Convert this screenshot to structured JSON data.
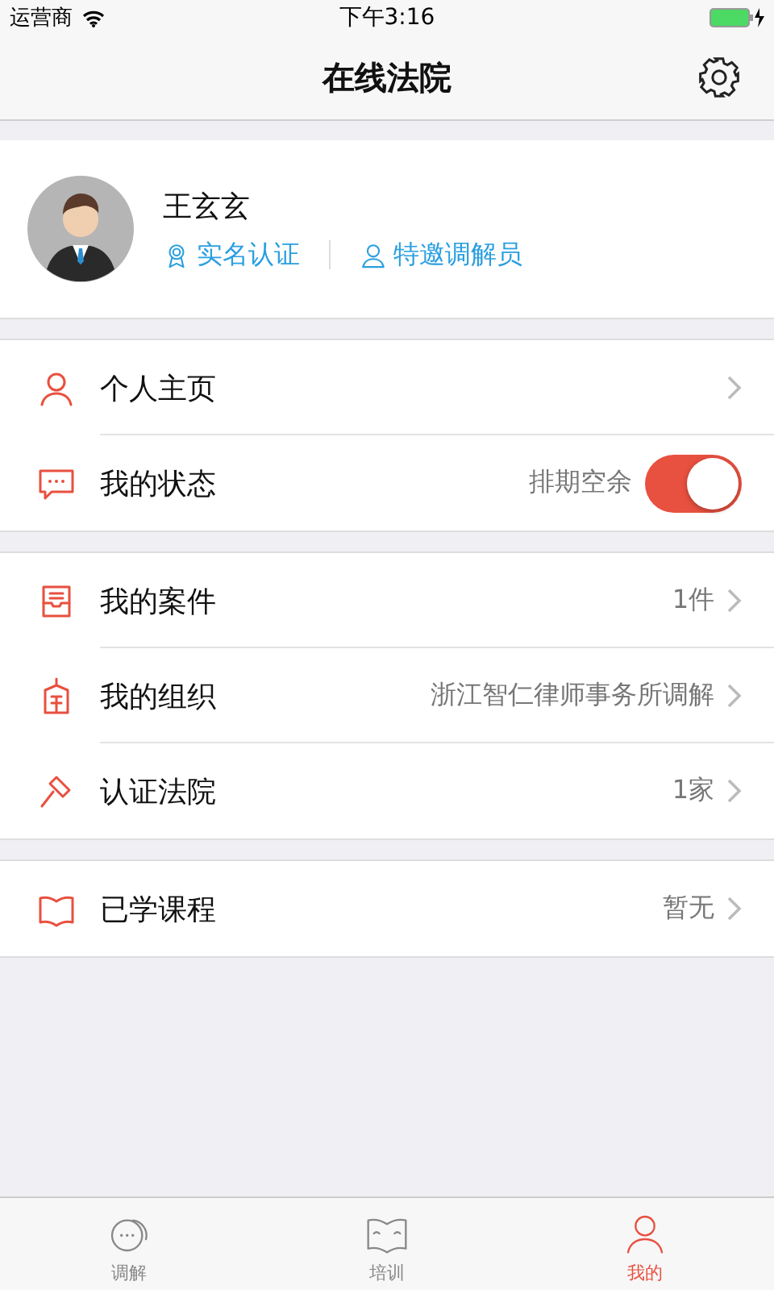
{
  "status_bar": {
    "carrier": "运营商",
    "time": "下午3:16"
  },
  "nav": {
    "title": "在线法院"
  },
  "profile": {
    "name": "王玄玄",
    "badges": [
      "实名认证",
      "特邀调解员"
    ]
  },
  "groups": [
    {
      "items": [
        {
          "kind": "link",
          "label": "个人主页"
        },
        {
          "kind": "toggle",
          "label": "我的状态",
          "value": "排期空余",
          "on": true
        }
      ]
    },
    {
      "items": [
        {
          "kind": "link",
          "label": "我的案件",
          "value": "1件"
        },
        {
          "kind": "link",
          "label": "我的组织",
          "value": "浙江智仁律师事务所调解"
        },
        {
          "kind": "link",
          "label": "认证法院",
          "value": "1家"
        }
      ]
    },
    {
      "items": [
        {
          "kind": "link",
          "label": "已学课程",
          "value": "暂无"
        }
      ]
    }
  ],
  "tabs": [
    {
      "label": "调解",
      "selected": false
    },
    {
      "label": "培训",
      "selected": false
    },
    {
      "label": "我的",
      "selected": true
    }
  ]
}
